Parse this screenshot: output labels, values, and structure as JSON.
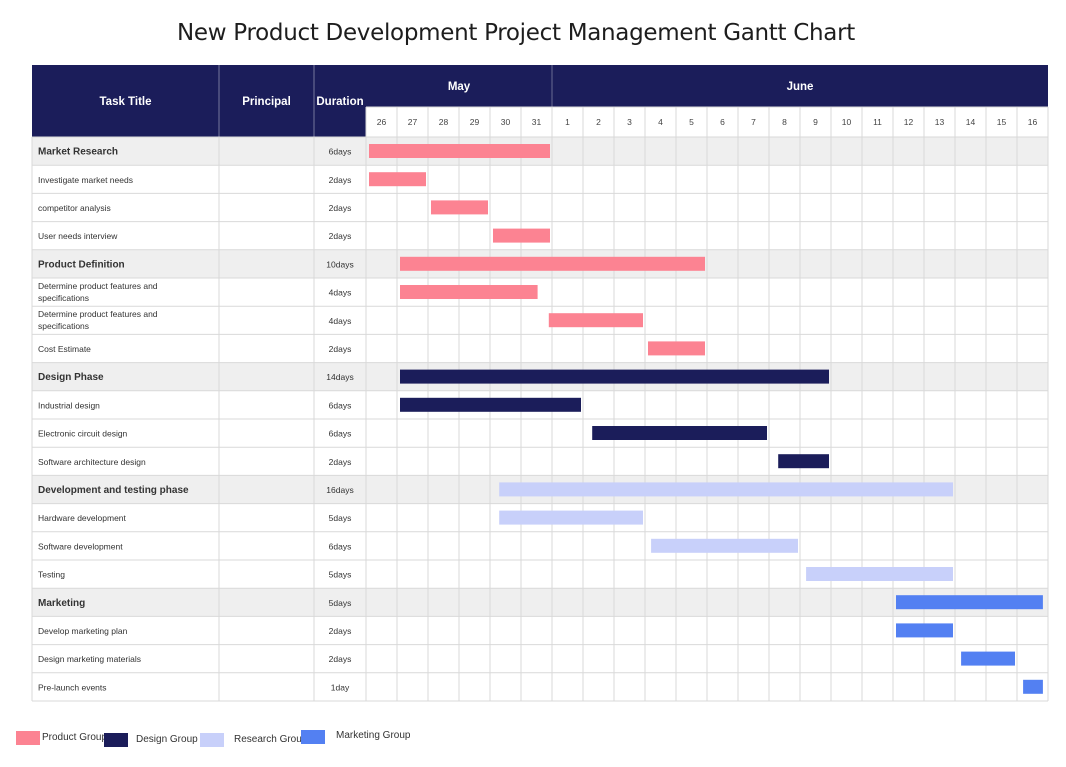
{
  "title": "New Product Development Project Management Gantt Chart",
  "headers": {
    "task": "Task Title",
    "principal": "Principal",
    "duration": "Duration"
  },
  "colors": {
    "header_bg": "#1b1d5a",
    "group_row_bg": "#efefef",
    "grid": "#d9d9d9",
    "Product Group": "#fc8392",
    "Design Group": "#1b1d5a",
    "Research Group": "#c8d0fa",
    "Marketing Group": "#5380f2"
  },
  "chart_data": {
    "type": "gantt",
    "title": "New Product Development Project Management Gantt Chart",
    "months": [
      {
        "name": "May",
        "days": 6
      },
      {
        "name": "June",
        "days": 16
      }
    ],
    "days": [
      "26",
      "27",
      "28",
      "29",
      "30",
      "31",
      "1",
      "2",
      "3",
      "4",
      "5",
      "6",
      "7",
      "8",
      "9",
      "10",
      "11",
      "12",
      "13",
      "14",
      "15",
      "16"
    ],
    "legend": [
      "Product Group",
      "Design Group",
      "Research Group",
      "Marketing Group"
    ],
    "tasks": [
      {
        "name": "Market Research",
        "duration": "6days",
        "group_header": true,
        "start": 0,
        "end": 6,
        "group": "Product Group"
      },
      {
        "name": "Investigate market needs",
        "duration": "2days",
        "start": 0,
        "end": 2,
        "group": "Product Group"
      },
      {
        "name": "competitor analysis",
        "duration": "2days",
        "start": 2,
        "end": 4,
        "group": "Product Group"
      },
      {
        "name": "User needs interview",
        "duration": "2days",
        "start": 4,
        "end": 6,
        "group": "Product Group"
      },
      {
        "name": "Product Definition",
        "duration": "10days",
        "group_header": true,
        "start": 1,
        "end": 11,
        "group": "Product Group"
      },
      {
        "name": "Determine product features and specifications",
        "duration": "4days",
        "start": 1,
        "end": 5.6,
        "group": "Product Group"
      },
      {
        "name": "Determine product features and specifications",
        "duration": "4days",
        "start": 5.8,
        "end": 9,
        "group": "Product Group"
      },
      {
        "name": "Cost Estimate",
        "duration": "2days",
        "start": 9,
        "end": 11,
        "group": "Product Group"
      },
      {
        "name": "Design Phase",
        "duration": "14days",
        "group_header": true,
        "start": 1,
        "end": 15,
        "group": "Design Group"
      },
      {
        "name": "Industrial design",
        "duration": "6days",
        "start": 1,
        "end": 7,
        "group": "Design Group"
      },
      {
        "name": "Electronic circuit design",
        "duration": "6days",
        "start": 7.2,
        "end": 13,
        "group": "Design Group"
      },
      {
        "name": "Software architecture design",
        "duration": "2days",
        "start": 13.2,
        "end": 15,
        "group": "Design Group"
      },
      {
        "name": "Development and testing phase",
        "duration": "16days",
        "group_header": true,
        "start": 4.2,
        "end": 19,
        "group": "Research Group"
      },
      {
        "name": "Hardware development",
        "duration": "5days",
        "start": 4.2,
        "end": 9,
        "group": "Research Group"
      },
      {
        "name": "Software development",
        "duration": "6days",
        "start": 9.1,
        "end": 14,
        "group": "Research Group"
      },
      {
        "name": "Testing",
        "duration": "5days",
        "start": 14.1,
        "end": 19,
        "group": "Research Group"
      },
      {
        "name": "Marketing",
        "duration": "5days",
        "group_header": true,
        "start": 17,
        "end": 21.9,
        "group": "Marketing Group"
      },
      {
        "name": "Develop marketing plan",
        "duration": "2days",
        "start": 17,
        "end": 19,
        "group": "Marketing Group"
      },
      {
        "name": "Design marketing materials",
        "duration": "2days",
        "start": 19.1,
        "end": 21,
        "group": "Marketing Group"
      },
      {
        "name": "Pre-launch events",
        "duration": "1day",
        "start": 21.1,
        "end": 21.9,
        "group": "Marketing Group"
      }
    ]
  }
}
